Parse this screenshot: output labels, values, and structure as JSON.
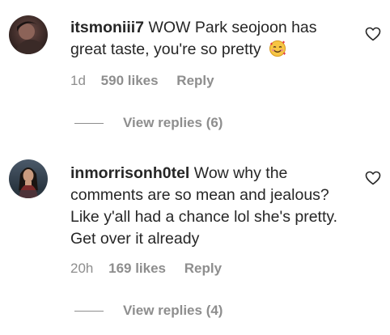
{
  "comments": [
    {
      "username": "itsmoniii7",
      "text": "WOW Park seojoon has great taste, you're so pretty",
      "emoji": "smiling-face-with-hearts",
      "time": "1d",
      "likes": "590 likes",
      "reply": "Reply",
      "view_replies": "View replies (6)"
    },
    {
      "username": "inmorrisonh0tel",
      "text": "Wow why the comments are so mean and jealous? Like y'all had a chance lol she's pretty. Get over it already",
      "time": "20h",
      "likes": "169 likes",
      "reply": "Reply",
      "view_replies": "View replies (4)"
    }
  ],
  "colors": {
    "text": "#262626",
    "secondary": "#8e8e8e",
    "background": "#ffffff"
  }
}
